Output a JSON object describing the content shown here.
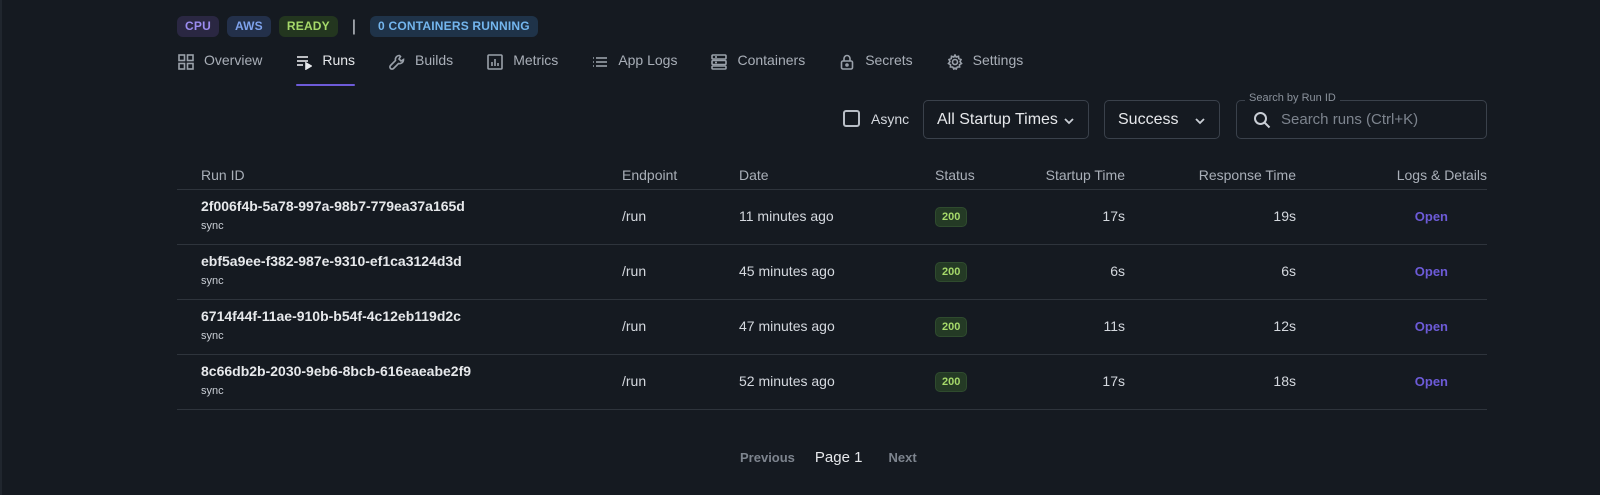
{
  "badges": {
    "cpu": "CPU",
    "aws": "AWS",
    "ready": "READY",
    "separator": "|",
    "running": "0 CONTAINERS RUNNING"
  },
  "tabs": [
    {
      "label": "Overview",
      "icon": "grid-icon"
    },
    {
      "label": "Runs",
      "icon": "runs-list-icon",
      "active": true
    },
    {
      "label": "Builds",
      "icon": "wrench-icon"
    },
    {
      "label": "Metrics",
      "icon": "bar-chart-icon"
    },
    {
      "label": "App Logs",
      "icon": "list-icon"
    },
    {
      "label": "Containers",
      "icon": "container-icon"
    },
    {
      "label": "Secrets",
      "icon": "lock-icon"
    },
    {
      "label": "Settings",
      "icon": "gear-icon"
    }
  ],
  "toolbar": {
    "async_label": "Async",
    "async_checked": false,
    "startup_filter": "All Startup Times",
    "status_filter": "Success",
    "search_legend": "Search by Run ID",
    "search_placeholder": "Search runs (Ctrl+K)"
  },
  "table": {
    "headers": {
      "run_id": "Run ID",
      "endpoint": "Endpoint",
      "date": "Date",
      "status": "Status",
      "startup_time": "Startup Time",
      "response_time": "Response Time",
      "logs": "Logs & Details"
    },
    "rows": [
      {
        "run_id": "2f006f4b-5a78-997a-98b7-779ea37a165d",
        "mode": "sync",
        "endpoint": "/run",
        "date": "11 minutes ago",
        "status": "200",
        "startup": "17s",
        "response": "19s",
        "open": "Open"
      },
      {
        "run_id": "ebf5a9ee-f382-987e-9310-ef1ca3124d3d",
        "mode": "sync",
        "endpoint": "/run",
        "date": "45 minutes ago",
        "status": "200",
        "startup": "6s",
        "response": "6s",
        "open": "Open"
      },
      {
        "run_id": "6714f44f-11ae-910b-b54f-4c12eb119d2c",
        "mode": "sync",
        "endpoint": "/run",
        "date": "47 minutes ago",
        "status": "200",
        "startup": "11s",
        "response": "12s",
        "open": "Open"
      },
      {
        "run_id": "8c66db2b-2030-9eb6-8bcb-616eaeabe2f9",
        "mode": "sync",
        "endpoint": "/run",
        "date": "52 minutes ago",
        "status": "200",
        "startup": "17s",
        "response": "18s",
        "open": "Open"
      }
    ]
  },
  "pagination": {
    "previous": "Previous",
    "page": "Page 1",
    "next": "Next"
  },
  "colors": {
    "accent": "#6d5bd8",
    "status_ok": "#a6d96a",
    "background": "#151a21"
  }
}
